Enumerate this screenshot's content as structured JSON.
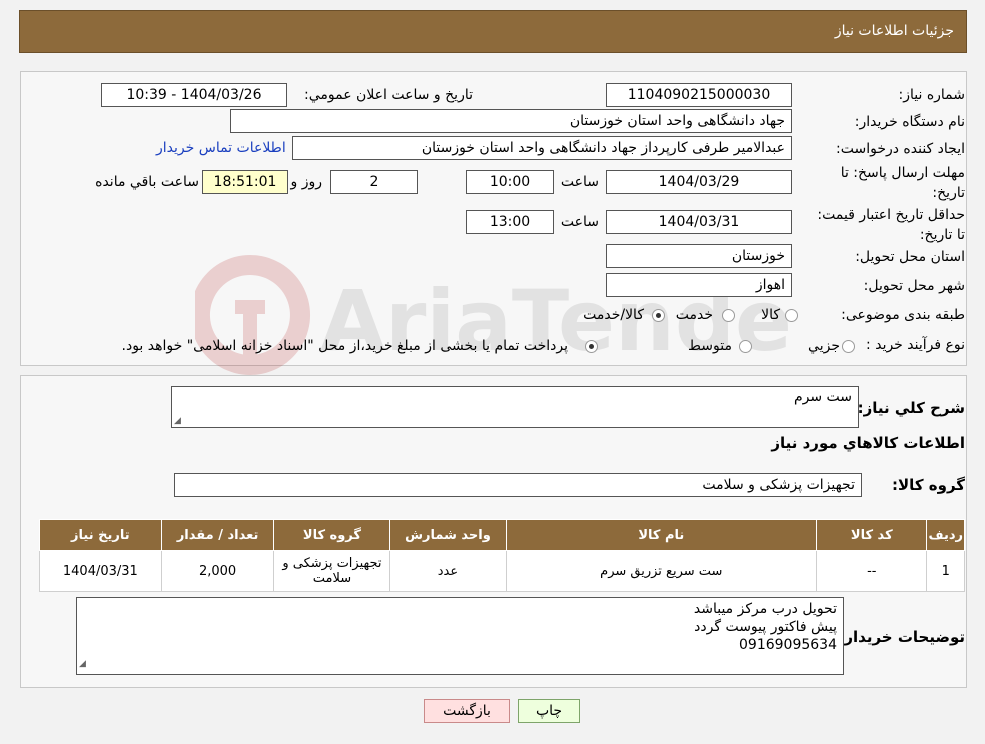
{
  "header": {
    "title": "جزئیات اطلاعات نیاز"
  },
  "form": {
    "need_number_label": "شماره نیاز:",
    "need_number": "1104090215000030",
    "announce_label": "تاریخ و ساعت اعلان عمومي:",
    "announce_value": "1404/03/26 - 10:39",
    "buyer_org_label": "نام دستگاه خريدار:",
    "buyer_org": "جهاد دانشگاهی واحد استان خوزستان",
    "requester_label": "ايجاد کننده درخواست:",
    "requester": "عبدالامیر طرفی کارپرداز جهاد دانشگاهی واحد استان خوزستان",
    "contact_link": "اطلاعات تماس خريدار",
    "deadline_label": "مهلت ارسال پاسخ: تا تاریخ:",
    "deadline_date": "1404/03/29",
    "time_label": "ساعت",
    "deadline_time": "10:00",
    "days_value": "2",
    "days_label": "روز و",
    "remaining_time": "18:51:01",
    "remaining_label": "ساعت باقي مانده",
    "validity_label": "حداقل تاریخ اعتبار قیمت: تا تاریخ:",
    "validity_date": "1404/03/31",
    "validity_time": "13:00",
    "province_label": "استان محل تحویل:",
    "province": "خوزستان",
    "city_label": "شهر محل تحویل:",
    "city": "اهواز",
    "category_label": "طبقه بندی موضوعی:",
    "category_options": [
      "کالا",
      "خدمت",
      "کالا/خدمت"
    ],
    "process_label": "نوع فرآيند خريد :",
    "process_options": [
      "جزيي",
      "متوسط"
    ],
    "process_note": "پرداخت تمام يا بخشی از مبلغ خريد،از محل \"اسناد خزانه اسلامی\" خواهد بود."
  },
  "summary": {
    "desc_label": "شرح کلي نياز:",
    "desc": "ست سرم",
    "goods_title": "اطلاعات کالاهاي مورد نياز",
    "group_label": "گروه کالا:",
    "group_value": "تجهیزات پزشکی و سلامت",
    "table": {
      "headers": [
        "رديف",
        "کد کالا",
        "نام کالا",
        "واحد شمارش",
        "گروه کالا",
        "تعداد / مقدار",
        "تاريخ نياز"
      ],
      "rows": [
        [
          "1",
          "--",
          "ست سریع تزریق سرم",
          "عدد",
          "تجهیزات پزشکی و سلامت",
          "2,000",
          "1404/03/31"
        ]
      ]
    },
    "buyer_notes_label": "توضيحات خريدار:",
    "buyer_notes": [
      "تحویل درب مرکز میباشد",
      "پیش فاکتور پیوست گردد",
      "09169095634"
    ]
  },
  "buttons": {
    "print": "چاپ",
    "back": "بازگشت"
  },
  "watermark": {
    "text": "AriaTender.neT"
  },
  "colors": {
    "header": "#8d6a3b",
    "link": "#1a3fbf",
    "print_bg": "#eeffdd",
    "back_bg": "#ffe0e0"
  }
}
